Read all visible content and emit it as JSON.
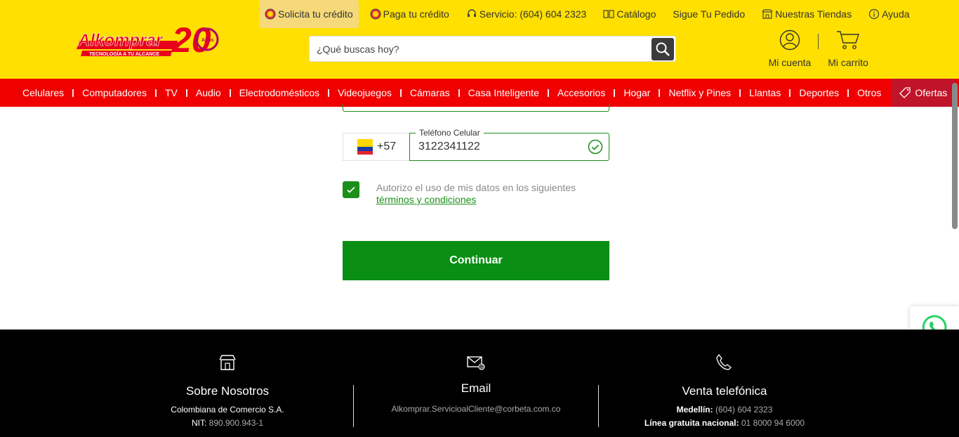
{
  "topbar": [
    {
      "label": "Solicita tu crédito",
      "icon": "credit-coin-icon",
      "active": true
    },
    {
      "label": "Paga tu crédito",
      "icon": "pay-coin-icon"
    },
    {
      "label": "Servicio: (604) 604 2323",
      "icon": "headset-icon"
    },
    {
      "label": "Catálogo",
      "icon": "catalog-icon"
    },
    {
      "label": "Sigue Tu Pedido",
      "icon": ""
    },
    {
      "label": "Nuestras Tiendas",
      "icon": "store-icon"
    },
    {
      "label": "Ayuda",
      "icon": "info-icon"
    }
  ],
  "logo": {
    "brand": "Alkomprar",
    "tagline": "TECNOLOGÍA A TU ALCANCE",
    "years": "20",
    "years_label": "Años"
  },
  "search": {
    "placeholder": "¿Qué buscas hoy?"
  },
  "account": {
    "label": "Mi cuenta"
  },
  "cart": {
    "label": "Mi carrito"
  },
  "nav": {
    "categories": [
      "Celulares",
      "Computadores",
      "TV",
      "Audio",
      "Electrodomésticos",
      "Videojuegos",
      "Cámaras",
      "Casa Inteligente",
      "Accesorios",
      "Hogar",
      "Netflix y Pines",
      "Llantas",
      "Deportes",
      "Otros"
    ],
    "ofertas": "Ofertas"
  },
  "form": {
    "country_code": "+57",
    "phone_label": "Teléfono Celular",
    "phone_value": "3122341122",
    "consent_text": "Autorizo el uso de mis datos en los siguientes",
    "consent_link": "términos y condiciones",
    "consent_checked": true,
    "continue_label": "Continuar"
  },
  "footer": {
    "about": {
      "title": "Sobre Nosotros",
      "company": "Colombiana de Comercio S.A.",
      "nit_label": "NIT:",
      "nit_value": "890.900.943-1"
    },
    "email": {
      "title": "Email",
      "address": "Alkomprar.ServicioalCliente@corbeta.com.co"
    },
    "phone": {
      "title": "Venta telefónica",
      "city_label": "Medellín:",
      "city_number": "(604) 604 2323",
      "national_label": "Línea gratuita nacional:",
      "national_number": "01 8000 94 6000"
    }
  },
  "colors": {
    "header": "#ffe000",
    "nav": "#f00000",
    "ofertas": "#c0142a",
    "green": "#0a8f14",
    "footer": "#000000"
  }
}
